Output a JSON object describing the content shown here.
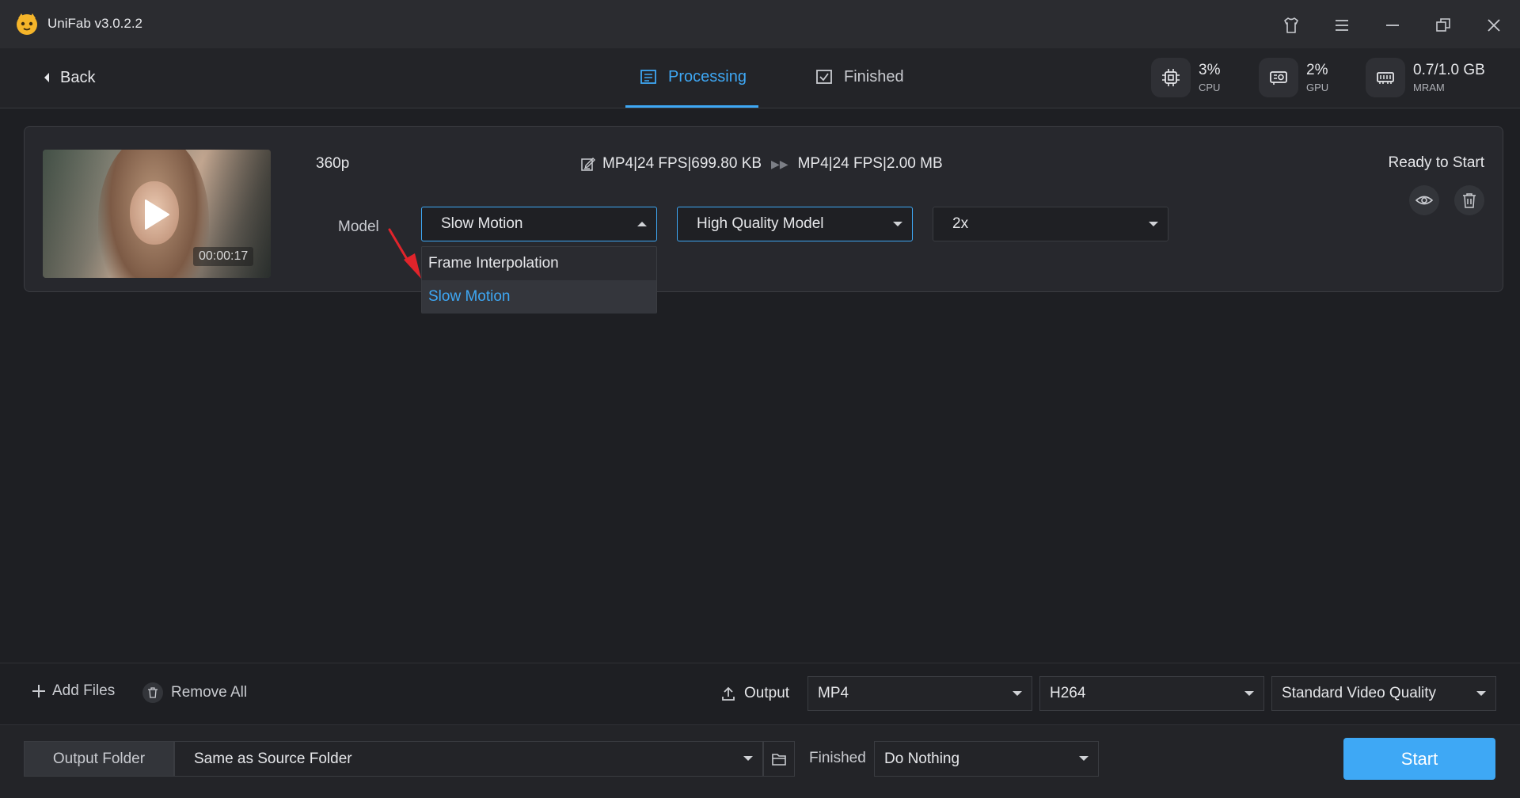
{
  "app": {
    "title": "UniFab v3.0.2.2"
  },
  "nav": {
    "back_label": "Back",
    "tabs": [
      {
        "label": "Processing",
        "active": true
      },
      {
        "label": "Finished",
        "active": false
      }
    ]
  },
  "stats": {
    "cpu": {
      "value": "3%",
      "label": "CPU"
    },
    "gpu": {
      "value": "2%",
      "label": "GPU"
    },
    "mram": {
      "value": "0.7/1.0 GB",
      "label": "MRAM"
    }
  },
  "task": {
    "resolution": "360p",
    "duration": "00:00:17",
    "source_format": "MP4|24 FPS|699.80 KB",
    "target_format": "MP4|24 FPS|2.00 MB",
    "status": "Ready to Start",
    "model_label": "Model",
    "model_select": {
      "value": "Slow Motion",
      "open": true,
      "options": [
        "Frame Interpolation",
        "Slow Motion"
      ],
      "highlighted": "Slow Motion"
    },
    "quality_select": {
      "value": "High Quality Model"
    },
    "multiplier_select": {
      "value": "2x"
    }
  },
  "bottom": {
    "add_files": "Add Files",
    "remove_all": "Remove All",
    "output_label": "Output",
    "container": "MP4",
    "codec": "H264",
    "video_quality": "Standard Video Quality",
    "output_folder_label": "Output Folder",
    "output_folder_value": "Same as Source Folder",
    "finished_label": "Finished",
    "finished_action": "Do Nothing",
    "start_label": "Start"
  },
  "colors": {
    "accent": "#3ea8f5",
    "background": "#1e1f23",
    "titlebar": "#2b2c30",
    "annotation_arrow": "#e0242b"
  }
}
